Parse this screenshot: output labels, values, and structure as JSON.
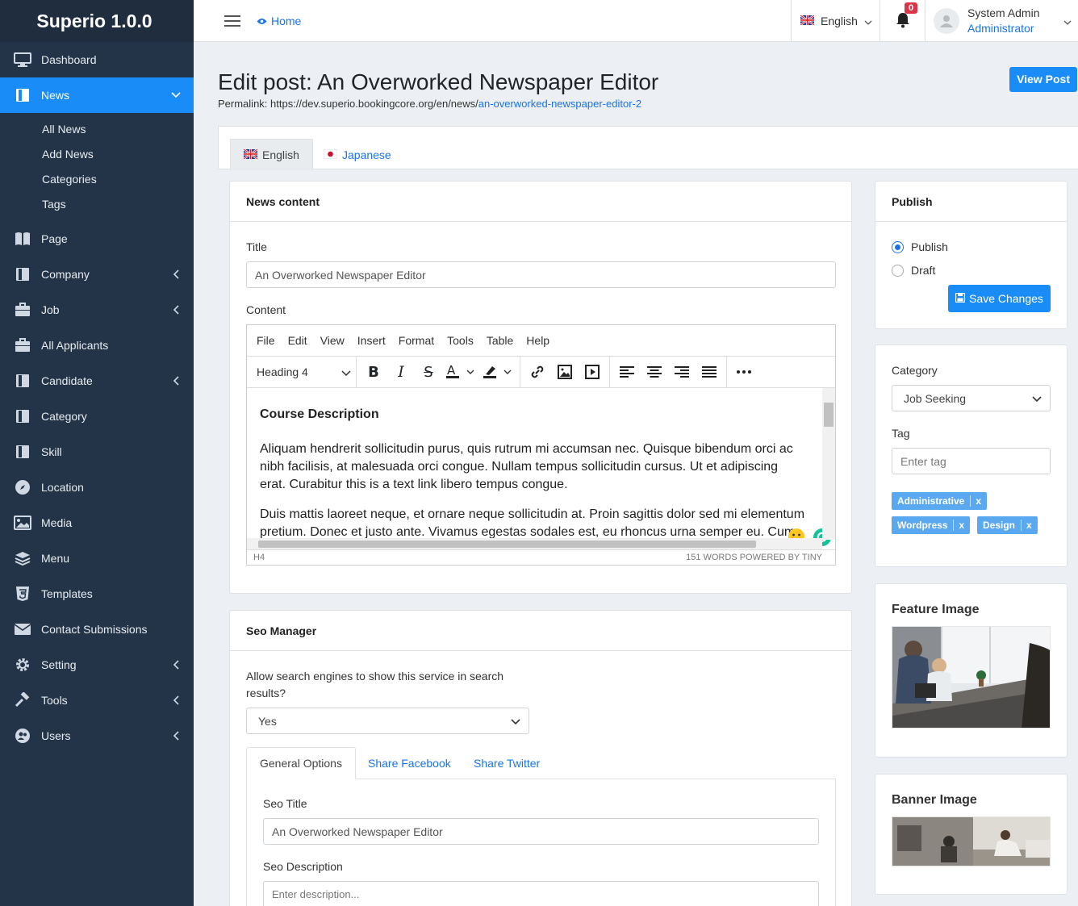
{
  "brand": "Superio 1.0.0",
  "sidebar": {
    "items": [
      {
        "label": "Dashboard",
        "icon": "monitor-icon"
      },
      {
        "label": "News",
        "icon": "book-icon"
      },
      {
        "label": "Page",
        "icon": "book-open-icon"
      },
      {
        "label": "Company",
        "icon": "book-icon"
      },
      {
        "label": "Job",
        "icon": "briefcase-icon"
      },
      {
        "label": "All Applicants",
        "icon": "briefcase-icon"
      },
      {
        "label": "Candidate",
        "icon": "book-icon"
      },
      {
        "label": "Category",
        "icon": "book-icon"
      },
      {
        "label": "Skill",
        "icon": "book-icon"
      },
      {
        "label": "Location",
        "icon": "compass-icon"
      },
      {
        "label": "Media",
        "icon": "image-icon"
      },
      {
        "label": "Menu",
        "icon": "layers-icon"
      },
      {
        "label": "Templates",
        "icon": "html5-icon"
      },
      {
        "label": "Contact Submissions",
        "icon": "envelope-icon"
      },
      {
        "label": "Setting",
        "icon": "cog-icon"
      },
      {
        "label": "Tools",
        "icon": "hammer-icon"
      },
      {
        "label": "Users",
        "icon": "users-icon"
      }
    ],
    "news_sub": [
      "All News",
      "Add News",
      "Categories",
      "Tags"
    ]
  },
  "topbar": {
    "home": "Home",
    "language": "English",
    "notifications": "0",
    "user_name": "System Admin",
    "user_role": "Administrator"
  },
  "page": {
    "title": "Edit post: An Overworked Newspaper Editor",
    "permalink_label": "Permalink: https://dev.superio.bookingcore.org/en/news/",
    "permalink_slug": "an-overworked-newspaper-editor-2",
    "view_post": "View Post"
  },
  "lang_tabs": [
    "English",
    "Japanese"
  ],
  "news_content": {
    "header": "News content",
    "title_label": "Title",
    "title_value": "An Overworked Newspaper Editor",
    "content_label": "Content",
    "menu": [
      "File",
      "Edit",
      "View",
      "Insert",
      "Format",
      "Tools",
      "Table",
      "Help"
    ],
    "format": "Heading 4",
    "heading": "Course Description",
    "para1": "Aliquam hendrerit sollicitudin purus, quis rutrum mi accumsan nec. Quisque bibendum orci ac nibh facilisis, at malesuada orci congue. Nullam tempus sollicitudin cursus. Ut et adipiscing erat. Curabitur this is a text link libero tempus congue.",
    "para2": "Duis mattis laoreet neque, et ornare neque sollicitudin at. Proin sagittis dolor sed mi elementum pretium. Donec et justo ante. Vivamus egestas sodales est, eu rhoncus urna semper eu. Cum",
    "status_path": "H4",
    "status_right": "151 WORDS  POWERED BY TINY"
  },
  "seo": {
    "header": "Seo Manager",
    "allow_label": "Allow search engines to show this service in search results?",
    "allow_value": "Yes",
    "tabs": [
      "General Options",
      "Share Facebook",
      "Share Twitter"
    ],
    "seo_title_label": "Seo Title",
    "seo_title_value": "An Overworked Newspaper Editor",
    "seo_desc_label": "Seo Description",
    "seo_desc_placeholder": "Enter description..."
  },
  "publish": {
    "header": "Publish",
    "options": [
      "Publish",
      "Draft"
    ],
    "selected": "Publish",
    "save": "Save Changes"
  },
  "taxonomy": {
    "category_label": "Category",
    "category_value": "Job Seeking",
    "tag_label": "Tag",
    "tag_placeholder": "Enter tag",
    "tags": [
      "Administrative",
      "Wordpress",
      "Design"
    ]
  },
  "feature_image": {
    "label": "Feature Image"
  },
  "banner_image": {
    "label": "Banner Image"
  },
  "colors": {
    "sidebar": "#243448",
    "accent": "#1a8cf8",
    "link": "#1a73e8"
  }
}
